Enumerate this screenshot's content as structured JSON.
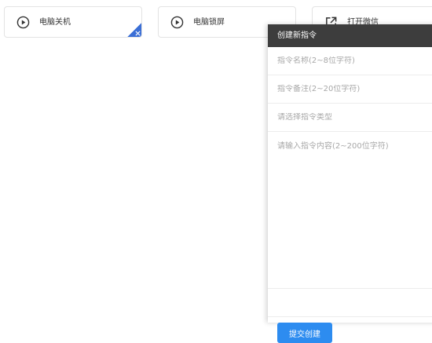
{
  "cards": [
    {
      "label": "电脑关机",
      "icon": "play-circle-icon"
    },
    {
      "label": "电脑锁屏",
      "icon": "play-circle-icon"
    },
    {
      "label": "打开微信",
      "icon": "external-link-icon"
    }
  ],
  "drawer": {
    "title": "创建新指令",
    "name_placeholder": "指令名称(2~8位字符)",
    "note_placeholder": "指令备注(2~20位字符)",
    "type_placeholder": "请选择指令类型",
    "content_placeholder": "请输入指令内容(2~200位字符)",
    "submit_label": "提交创建"
  },
  "colors": {
    "accent": "#2d8cf0",
    "header_bg": "#3d3d3d",
    "tag": "#3b6fd6"
  }
}
